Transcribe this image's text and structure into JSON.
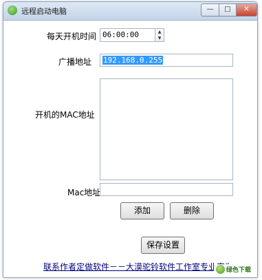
{
  "window": {
    "title": "远程启动电脑",
    "minimize_glyph": "—",
    "maximize_glyph": "□",
    "close_glyph": "✕"
  },
  "form": {
    "daily_boot_label": "每天开机时间",
    "daily_boot_time": "06:00:00",
    "broadcast_label": "广播地址",
    "broadcast_value": "192.168.0.255",
    "boot_mac_label": "开机的MAC地址",
    "boot_mac_list": "",
    "mac_label": "Mac地址",
    "mac_value": ""
  },
  "buttons": {
    "add": "添加",
    "delete": "删除",
    "save": "保存设置"
  },
  "footer": {
    "contact_link": "联系作者定做软件－－大漠驼铃软件工作室专业定做"
  },
  "watermark": {
    "text": "绿色下载"
  },
  "icons": {
    "app": "app-icon",
    "spin_up": "▲",
    "spin_down": "▼"
  }
}
